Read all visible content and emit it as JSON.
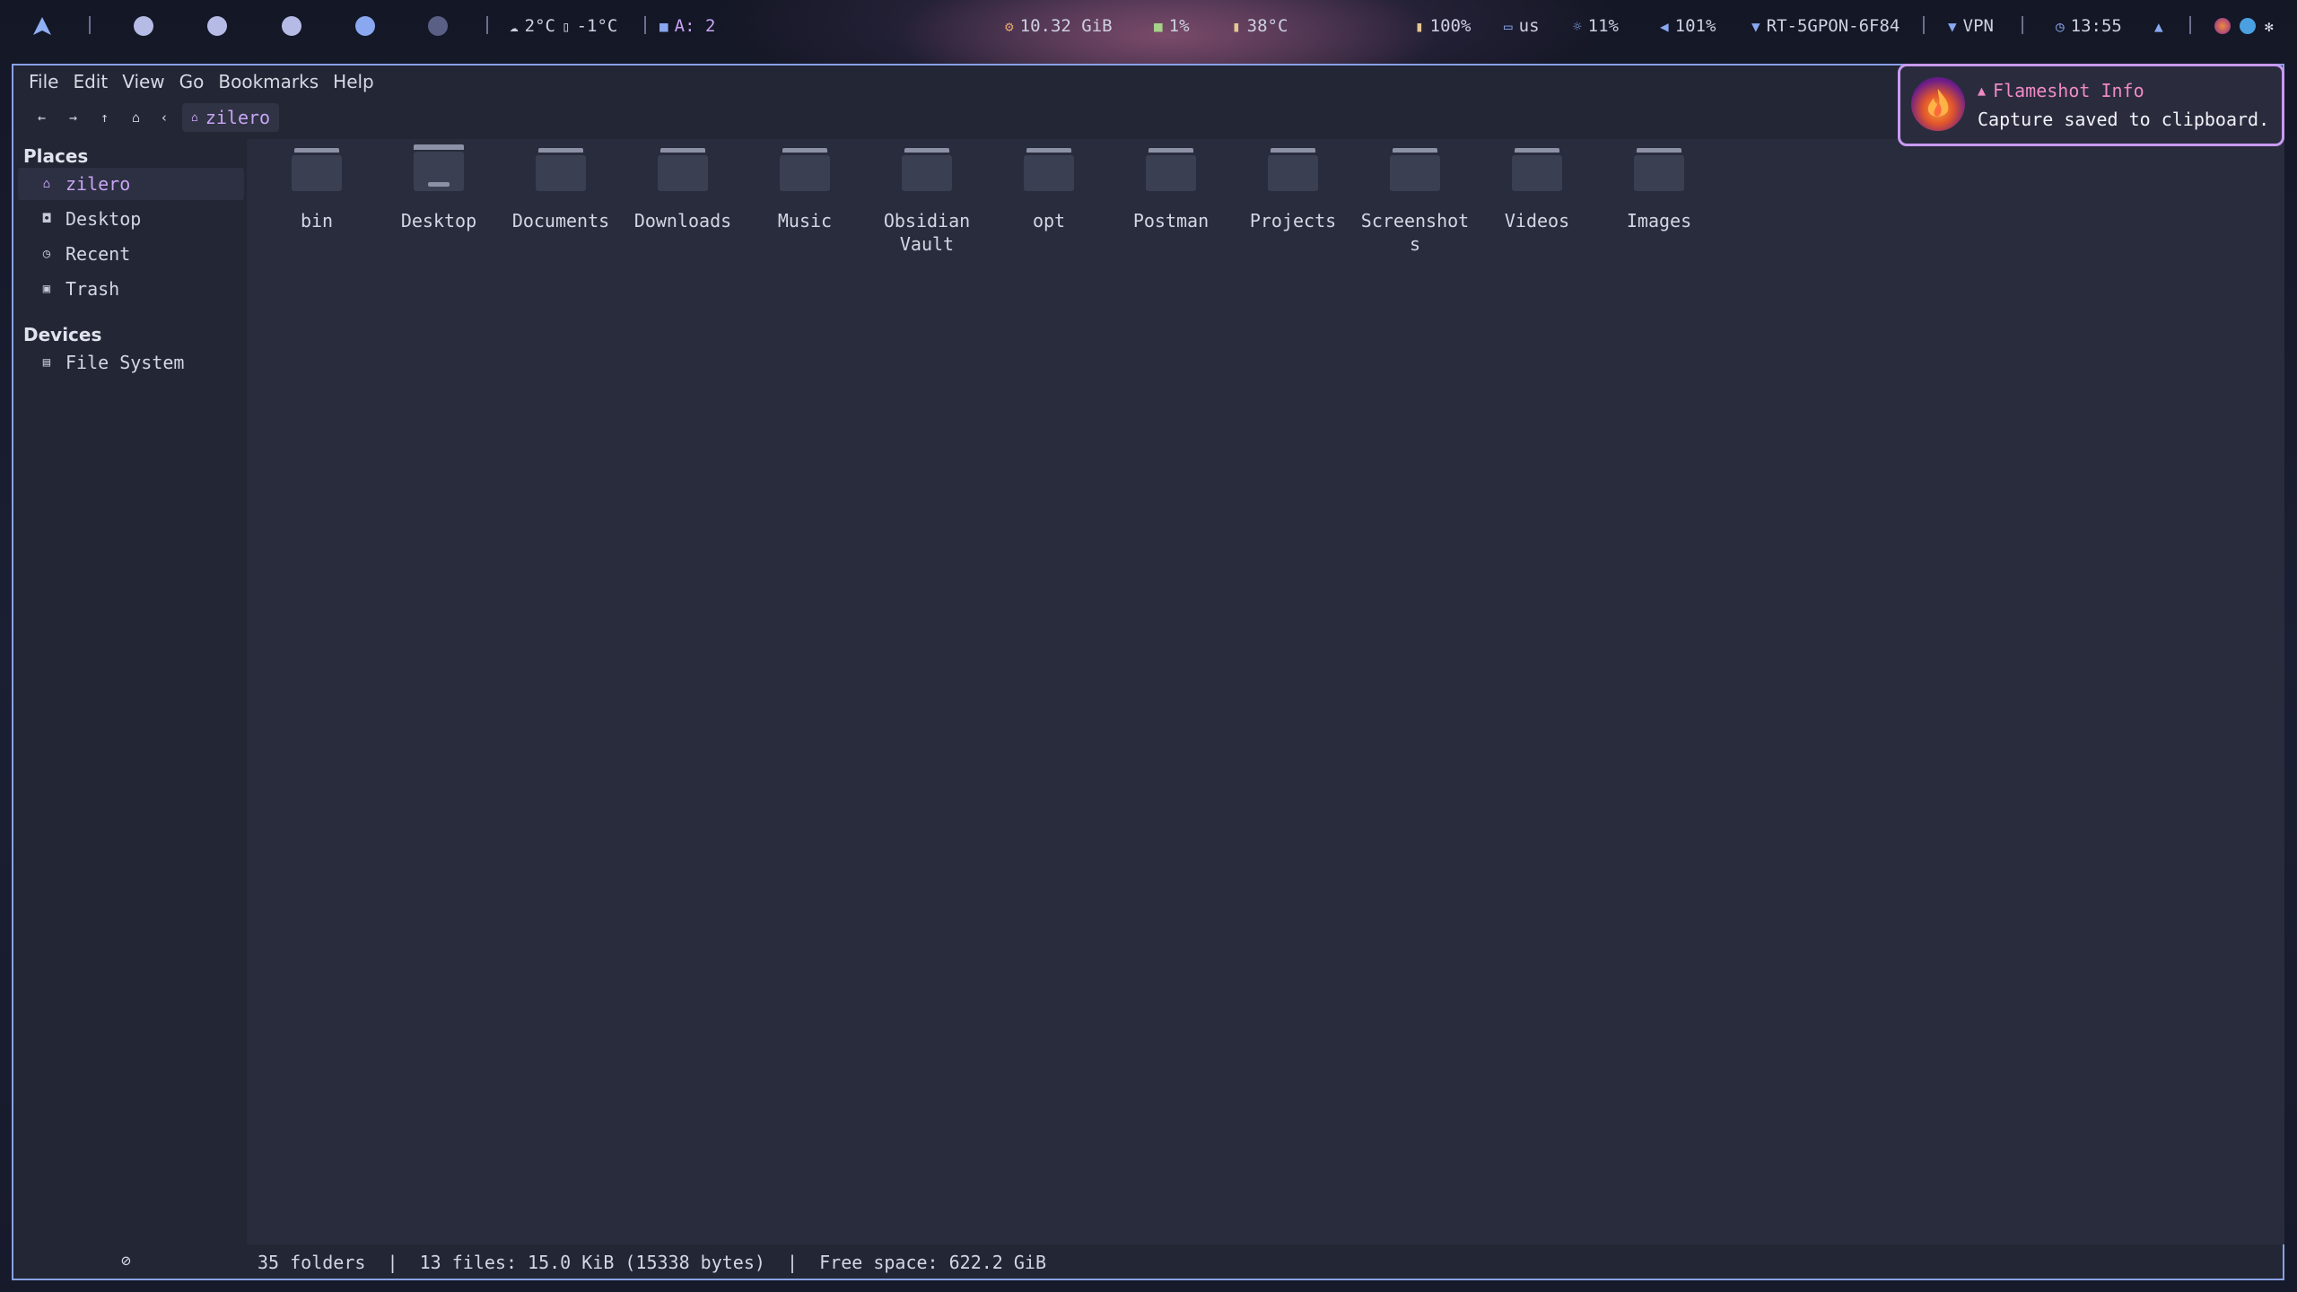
{
  "topbar": {
    "launcher_icon": "arch-logo-icon",
    "workspaces": [
      {
        "id": "1",
        "color": "#b6bbe6"
      },
      {
        "id": "2",
        "color": "#b6bbe6"
      },
      {
        "id": "3",
        "color": "#b6bbe6"
      },
      {
        "id": "4",
        "color": "#8aa8f0"
      },
      {
        "id": "5",
        "color": "#5a5f86"
      }
    ],
    "weather": "2°C",
    "weather_icon": "cloud-icon",
    "temp_low": "-1°C",
    "temp_low_icon": "thermometer-icon",
    "updates": "A: 2",
    "updates_icon": "package-icon",
    "memory": "10.32 GiB",
    "memory_icon": "memory-icon",
    "cpu": "1%",
    "cpu_icon": "chip-icon",
    "cpu_temp": "38°C",
    "cpu_temp_icon": "thermometer-icon",
    "battery": "100%",
    "battery_icon": "battery-icon",
    "keyboard": "us",
    "keyboard_icon": "keyboard-icon",
    "brightness": "11%",
    "brightness_icon": "brightness-icon",
    "volume": "101%",
    "volume_icon": "volume-icon",
    "wifi": "RT-5GPON-6F84",
    "wifi_icon": "wifi-icon",
    "vpn": "VPN",
    "vpn_icon": "vpn-icon",
    "clock": "13:55",
    "clock_icon": "clock-icon",
    "notifications_icon": "bell-icon",
    "tray": [
      "flameshot-tray-icon",
      "telegram-tray-icon",
      "settings-tray-icon"
    ]
  },
  "menubar": [
    "File",
    "Edit",
    "View",
    "Go",
    "Bookmarks",
    "Help"
  ],
  "toolbar": {
    "back_icon": "arrow-left-icon",
    "forward_icon": "arrow-right-icon",
    "up_icon": "arrow-up-icon",
    "home_icon": "home-icon",
    "breadcrumb_prev_icon": "chevron-left-icon",
    "path": "zilero"
  },
  "sidebar": {
    "places_title": "Places",
    "places": [
      {
        "label": "zilero",
        "icon": "home-icon",
        "active": true
      },
      {
        "label": "Desktop",
        "icon": "desktop-icon",
        "active": false
      },
      {
        "label": "Recent",
        "icon": "clock-icon",
        "active": false
      },
      {
        "label": "Trash",
        "icon": "trash-icon",
        "active": false
      }
    ],
    "devices_title": "Devices",
    "devices": [
      {
        "label": "File System",
        "icon": "drive-icon"
      }
    ]
  },
  "files": [
    {
      "name": "bin",
      "type": "folder"
    },
    {
      "name": "Desktop",
      "type": "folder-desktop"
    },
    {
      "name": "Documents",
      "type": "folder"
    },
    {
      "name": "Downloads",
      "type": "folder"
    },
    {
      "name": "Music",
      "type": "folder"
    },
    {
      "name": "Obsidian Vault",
      "type": "folder"
    },
    {
      "name": "opt",
      "type": "folder"
    },
    {
      "name": "Postman",
      "type": "folder"
    },
    {
      "name": "Projects",
      "type": "folder"
    },
    {
      "name": "Screenshots",
      "type": "folder"
    },
    {
      "name": "Videos",
      "type": "folder"
    },
    {
      "name": "Images",
      "type": "folder"
    }
  ],
  "statusbar": {
    "icon": "no-entry-icon",
    "text": "35 folders  |  13 files: 15.0 KiB (15338 bytes)  |  Free space: 622.2 GiB"
  },
  "notification": {
    "app_icon": "flameshot-icon",
    "title_icon": "bell-icon",
    "title": "Flameshot Info",
    "body": "Capture saved to clipboard."
  }
}
